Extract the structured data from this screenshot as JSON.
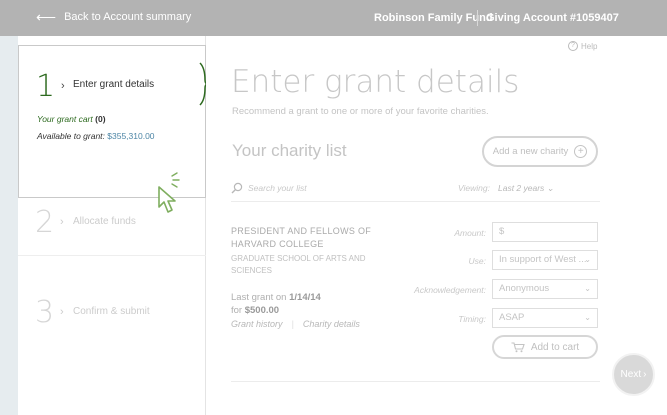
{
  "topbar": {
    "back_label": "Back to Account summary",
    "fund_name": "Robinson Family Fund",
    "account": "Giving Account #1059407"
  },
  "steps": [
    {
      "number": "1",
      "label": "Enter grant details",
      "state": "active"
    },
    {
      "number": "2",
      "label": "Allocate funds",
      "state": "inactive"
    },
    {
      "number": "3",
      "label": "Confirm & submit",
      "state": "inactive"
    }
  ],
  "cart": {
    "label": "Your grant cart",
    "count": "(0)",
    "available_label": "Available to grant:",
    "available_amount": "$355,310.00"
  },
  "help": {
    "label": "Help",
    "icon": "question-icon"
  },
  "main": {
    "heading": "Enter grant details",
    "subheading": "Recommend a grant to one or more of your favorite charities.",
    "list_title": "Your charity list",
    "add_button": "Add a new charity"
  },
  "search": {
    "placeholder": "Search your list",
    "viewing_label": "Viewing:",
    "viewing_value": "Last 2 years"
  },
  "charity": {
    "name_line1": "PRESIDENT AND FELLOWS OF",
    "name_line2": "HARVARD COLLEGE",
    "dept_line1": "GRADUATE SCHOOL OF ARTS AND",
    "dept_line2": "SCIENCES",
    "last_grant_prefix": "Last grant on",
    "last_grant_date": "1/14/14",
    "last_grant_for": "for",
    "last_grant_amount": "$500.00",
    "link_history": "Grant history",
    "link_details": "Charity details"
  },
  "form": {
    "amount_label": "Amount:",
    "amount_placeholder": "$",
    "use_label": "Use:",
    "use_value": "In support of West ...",
    "ack_label": "Acknowledgement:",
    "ack_value": "Anonymous",
    "timing_label": "Timing:",
    "timing_value": "ASAP",
    "add_to_cart": "Add to cart"
  },
  "next_button": "Next",
  "colors": {
    "accent_green": "#2d6a1f",
    "link_blue": "#4d86a6",
    "topbar": "#b3b3b3",
    "background": "#e6ecef"
  }
}
